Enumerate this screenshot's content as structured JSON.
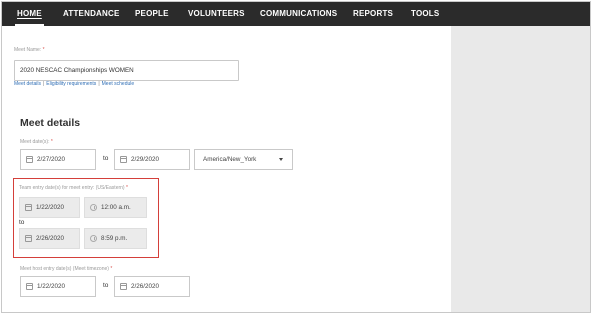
{
  "nav": {
    "items": [
      "HOME",
      "ATTENDANCE",
      "PEOPLE",
      "VOLUNTEERS",
      "COMMUNICATIONS",
      "REPORTS",
      "TOOLS"
    ],
    "active": "HOME"
  },
  "meet_name": {
    "label": "Meet Name:",
    "required_mark": "*",
    "value": "2020 NESCAC Championships WOMEN"
  },
  "links": {
    "meet_details": "Meet details",
    "separator": "|",
    "eligibility": "Eligibility requirements",
    "meet_schedule": "Meet schedule"
  },
  "section_title": "Meet details",
  "meet_dates": {
    "label": "Meet date(s):",
    "required_mark": "*",
    "start": "2/27/2020",
    "to": "to",
    "end": "2/29/2020",
    "timezone": "America/New_York"
  },
  "team_entry": {
    "label": "Team entry date(s) for meet entry: (US/Eastern)",
    "required_mark": "*",
    "start_date": "1/22/2020",
    "start_time": "12:00 a.m.",
    "to": "to",
    "end_date": "2/26/2020",
    "end_time": "8:59 p.m."
  },
  "host_entry": {
    "label": "Meet host entry date(s) (Meet timezone)",
    "required_mark": "*",
    "start": "1/22/2020",
    "to": "to",
    "end": "2/26/2020"
  },
  "colors": {
    "nav_bg": "#2b2b2b",
    "side_panel": "#e9e9e9",
    "link": "#2f6eb5",
    "highlight": "#d43f3a",
    "required": "#d9534f"
  },
  "icons": [
    "calendar-icon",
    "clock-icon",
    "caret-down-icon"
  ]
}
